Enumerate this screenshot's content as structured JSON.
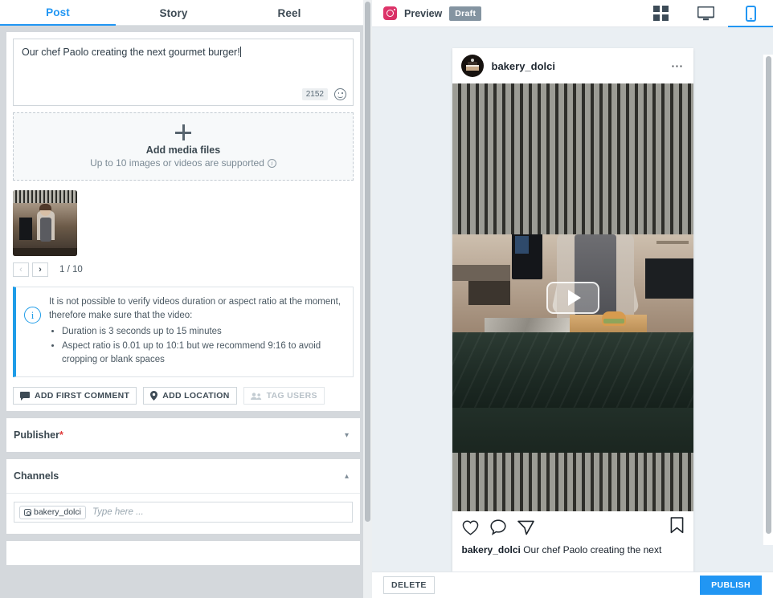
{
  "tabs": [
    {
      "label": "Post",
      "active": true
    },
    {
      "label": "Story",
      "active": false
    },
    {
      "label": "Reel",
      "active": false
    }
  ],
  "composer": {
    "text": "Our chef Paolo creating the next gourmet burger!",
    "char_counter": "2152",
    "emoji_icon": "smiley-face-icon"
  },
  "dropzone": {
    "plus_icon": "plus-icon",
    "title": "Add media files",
    "subtitle": "Up to 10 images or videos are supported",
    "info_icon": "info-icon"
  },
  "media": {
    "prev_label": "‹",
    "next_label": "›",
    "pager": "1 / 10",
    "thumb_alt": "chef-thumbnail"
  },
  "notice": {
    "icon": "info-icon",
    "text": "It is not possible to verify videos duration or aspect ratio at the moment, therefore make sure that the video:",
    "bullets": [
      "Duration is 3 seconds up to 15 minutes",
      "Aspect ratio is 0.01 up to 10:1 but we recommend 9:16 to avoid cropping or blank spaces"
    ]
  },
  "actions": [
    {
      "label": "ADD FIRST COMMENT",
      "icon": "comment-icon",
      "disabled": false
    },
    {
      "label": "ADD LOCATION",
      "icon": "location-pin-icon",
      "disabled": false
    },
    {
      "label": "TAG USERS",
      "icon": "tag-users-icon",
      "disabled": true
    }
  ],
  "panels": [
    {
      "title": "Publisher",
      "required": true,
      "expanded": false,
      "chevron": "chevron-down-icon"
    },
    {
      "title": "Channels",
      "required": false,
      "expanded": true,
      "chevron": "chevron-up-icon"
    }
  ],
  "channels": {
    "chip_label": "bakery_dolci",
    "chip_icon": "instagram-icon",
    "input_placeholder": "Type here ..."
  },
  "preview": {
    "platform_icon": "instagram-icon",
    "label": "Preview",
    "status_badge": "Draft",
    "view_modes": [
      {
        "name": "grid-view-icon",
        "active": false
      },
      {
        "name": "desktop-view-icon",
        "active": false
      },
      {
        "name": "mobile-view-icon",
        "active": true
      }
    ]
  },
  "post": {
    "username": "bakery_dolci",
    "avatar_icon": "bakery-avatar",
    "more_icon": "more-options-icon",
    "play_icon": "play-button-icon",
    "actions": [
      "like-heart-icon",
      "comment-bubble-icon",
      "share-paper-plane-icon",
      "save-bookmark-icon"
    ],
    "caption_user": "bakery_dolci",
    "caption_text": " Our chef Paolo creating the next"
  },
  "footer": {
    "delete_label": "DELETE",
    "publish_label": "PUBLISH"
  },
  "colors": {
    "accent": "#2196f3",
    "instagram": "#d62e64",
    "required": "#e03b3b",
    "draft_badge": "#8494a1"
  }
}
